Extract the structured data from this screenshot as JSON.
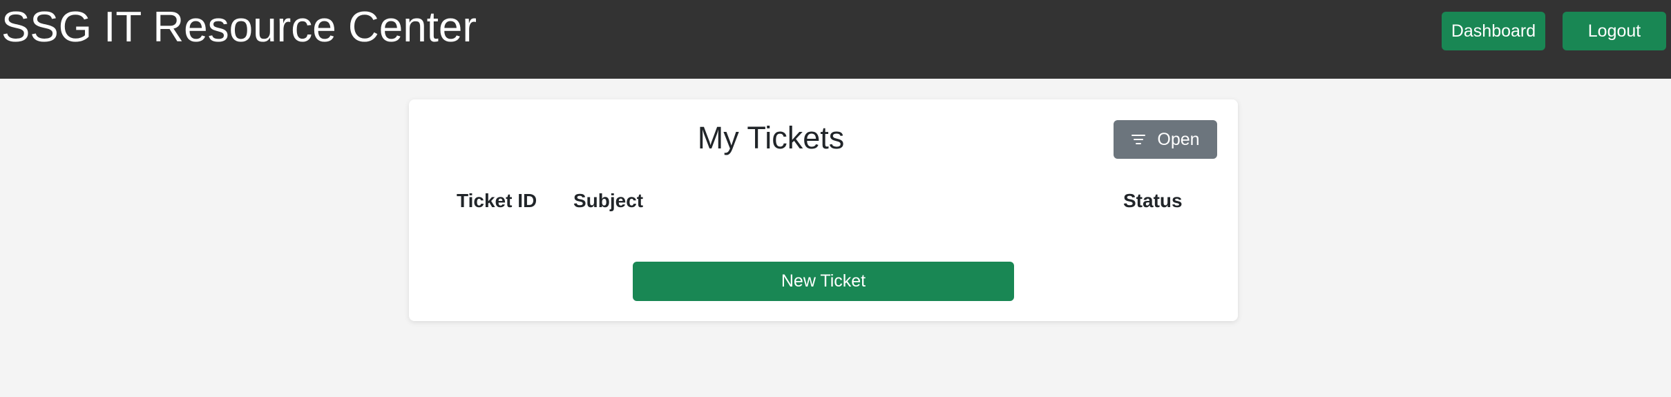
{
  "header": {
    "title": "SSG IT Resource Center",
    "dashboard_label": "Dashboard",
    "logout_label": "Logout"
  },
  "tickets_card": {
    "title": "My Tickets",
    "filter": {
      "icon": "filter-icon",
      "selected_label": "Open"
    },
    "table": {
      "columns": [
        "Ticket ID",
        "Subject",
        "Status"
      ],
      "rows": []
    },
    "new_ticket_label": "New Ticket"
  },
  "colors": {
    "header_bg": "#333333",
    "page_bg": "#f4f4f4",
    "primary_green": "#198754",
    "filter_gray": "#6c757d"
  }
}
